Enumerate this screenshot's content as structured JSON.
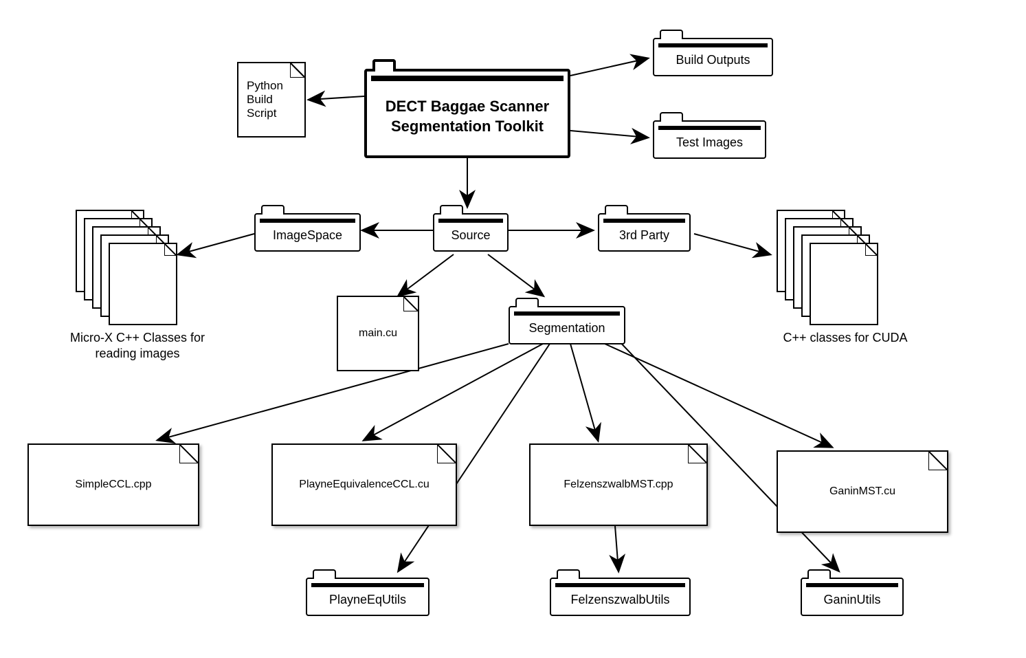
{
  "root": {
    "label": "DECT Baggae Scanner Segmentation Toolkit"
  },
  "top": {
    "python_script": "Python Build Script",
    "build_outputs": "Build Outputs",
    "test_images": "Test Images"
  },
  "level2": {
    "imagespace": "ImageSpace",
    "source": "Source",
    "third_party": "3rd Party"
  },
  "stacks": {
    "left_caption": "Micro-X C++ Classes for reading images",
    "right_caption": "C++ classes for CUDA"
  },
  "level3": {
    "main_cu": "main.cu",
    "segmentation": "Segmentation"
  },
  "files": {
    "simple_ccl": "SimpleCCL.cpp",
    "playne_ccl": "PlayneEquivalenceCCL.cu",
    "felz_mst": "FelzenszwalbMST.cpp",
    "ganin_mst": "GaninMST.cu"
  },
  "utils": {
    "playne": "PlayneEqUtils",
    "felz": "FelzenszwalbUtils",
    "ganin": "GaninUtils"
  }
}
